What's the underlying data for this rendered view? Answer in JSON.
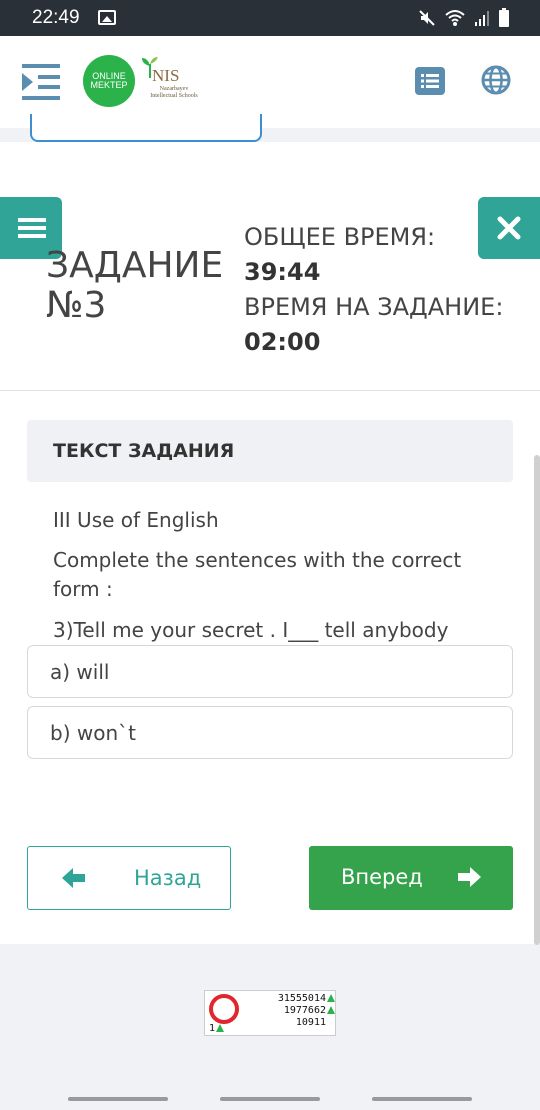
{
  "status_bar": {
    "time": "22:49",
    "icons": [
      "gallery-icon",
      "mute-icon",
      "wifi-icon",
      "signal-icon",
      "battery-icon"
    ]
  },
  "header": {
    "logo_line1": "ONLINE",
    "logo_line2": "MEKTEP",
    "nis_title": "NIS",
    "nis_subtitle": "Nazarbayev Intellectual Schools",
    "icons": [
      "menu-collapse-icon",
      "list-icon",
      "globe-icon"
    ],
    "accent": "#2cb24a"
  },
  "task": {
    "title": "ЗАДАНИЕ №3",
    "total_time_label": "ОБЩЕЕ ВРЕМЯ:",
    "total_time_value": "39:44",
    "task_time_label": "ВРЕМЯ НА ЗАДАНИЕ:",
    "task_time_value": "02:00",
    "text_header": "ТЕКСТ ЗАДАНИЯ",
    "section": "III Use of English",
    "instruction": "Complete the sentences with the correct form :",
    "sentence": "3)Tell me your secret . I___ tell anybody",
    "options": [
      {
        "label": "a) will"
      },
      {
        "label": "b) won`t"
      }
    ],
    "accent": "#2fa497"
  },
  "navigation": {
    "back_label": "Назад",
    "next_label": "Вперед",
    "next_color": "#35a34c"
  },
  "counter": {
    "line1": "31555014",
    "line2": "1977662",
    "line3": "10911",
    "small": "1"
  }
}
